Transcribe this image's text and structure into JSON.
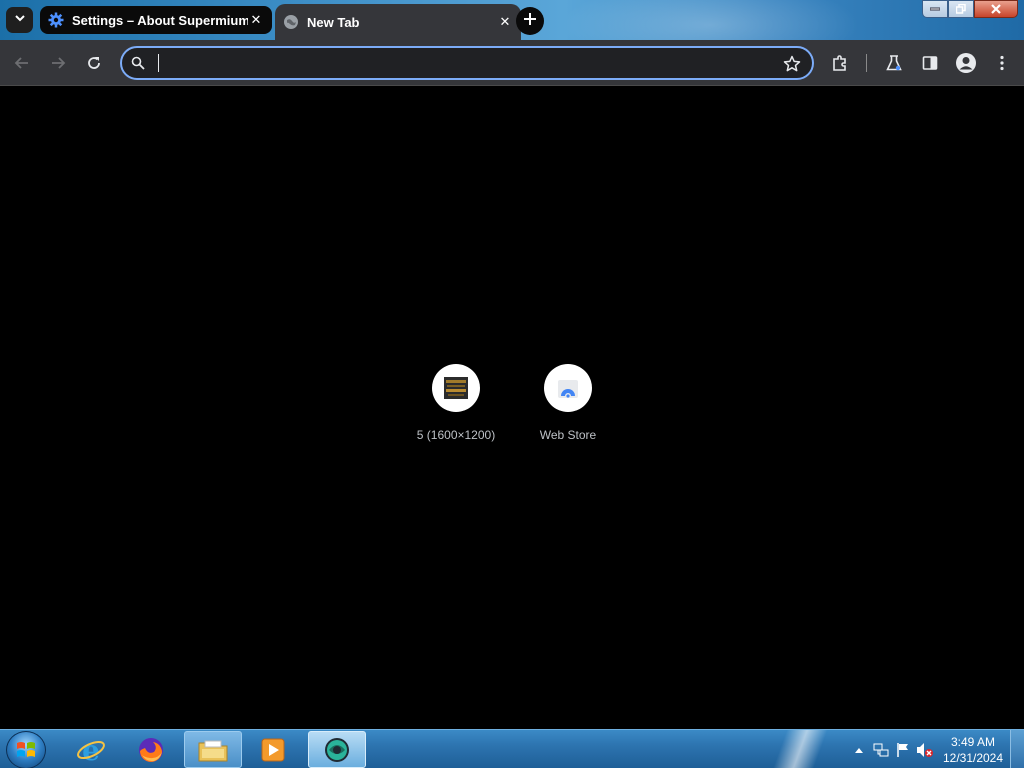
{
  "tabs": [
    {
      "title": "Settings – About Supermium",
      "favicon": "gear-icon",
      "active": false
    },
    {
      "title": "New Tab",
      "favicon": "globe-icon",
      "active": true
    }
  ],
  "window_controls": [
    "minimize",
    "restore",
    "close"
  ],
  "toolbar": {
    "back": "back-arrow-icon",
    "forward": "forward-arrow-icon",
    "reload": "reload-icon",
    "extensions": "puzzle-icon",
    "labs": "flask-icon",
    "side_panel": "side-panel-icon",
    "profile": "profile-icon",
    "menu": "kebab-menu-icon"
  },
  "omnibox": {
    "value": "",
    "placeholder": ""
  },
  "shortcuts": [
    {
      "label": "5 (1600×1200)",
      "icon": "thumbnail-image"
    },
    {
      "label": "Web Store",
      "icon": "web-store-icon"
    }
  ],
  "taskbar": {
    "items": [
      "start-orb",
      "internet-explorer-icon",
      "firefox-icon",
      "file-explorer-icon",
      "media-player-icon",
      "supermium-icon"
    ],
    "clock_time": "3:49 AM",
    "clock_date": "12/31/2024"
  },
  "colors": {
    "tab_strip": "#3e8fc7",
    "toolbar": "#35363a",
    "omnibox_bg": "#202124",
    "omnibox_focus": "#7cacf8",
    "content_bg": "#000000",
    "shortcut_label": "#bdc1c6"
  }
}
